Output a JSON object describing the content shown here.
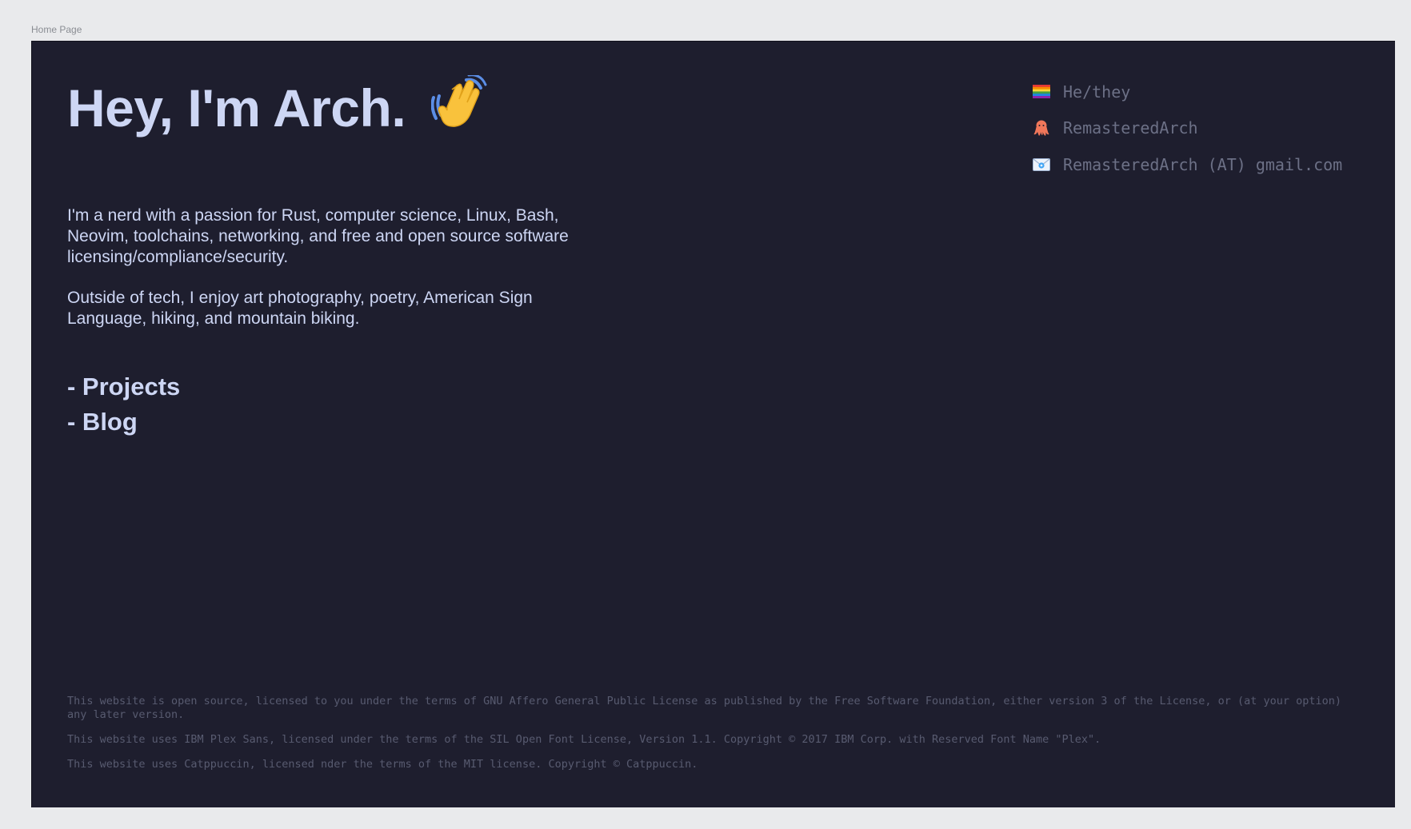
{
  "frame_label": "Home Page",
  "hero": {
    "title": "Hey, I'm Arch.",
    "emoji": "waving-hand-icon"
  },
  "bio": {
    "paragraph1": "I'm a nerd with a passion for Rust, computer science, Linux, Bash, Neovim, toolchains, networking, and free and open source software licensing/compliance/security.",
    "paragraph2": "Outside of tech, I enjoy art photography, poetry, American Sign Language, hiking, and mountain biking."
  },
  "nav": {
    "projects": "- Projects",
    "blog": "- Blog"
  },
  "contact": {
    "pronouns": {
      "icon": "rainbow-flag-icon",
      "text": "He/they"
    },
    "github": {
      "icon": "octopus-icon",
      "text": "RemasteredArch"
    },
    "email": {
      "icon": "envelope-icon",
      "text": "RemasteredArch (AT) gmail.com"
    }
  },
  "footer": {
    "license": "This website is open source, licensed to you under the terms of GNU Affero General Public License as published by the Free Software Foundation, either version 3 of the License, or (at your option) any later version.",
    "font": "This website uses IBM Plex Sans, licensed under the terms of the SIL Open Font License, Version 1.1. Copyright © 2017 IBM Corp. with Reserved Font Name \"Plex\".",
    "theme": "This website uses Catppuccin, licensed nder the terms of the MIT license. Copyright © Catppuccin."
  },
  "colors": {
    "page_background": "#e9eaec",
    "base": "#1e1e2e",
    "text": "#cdd6f4",
    "overlay": "#6c7086",
    "surface": "#585b70"
  }
}
